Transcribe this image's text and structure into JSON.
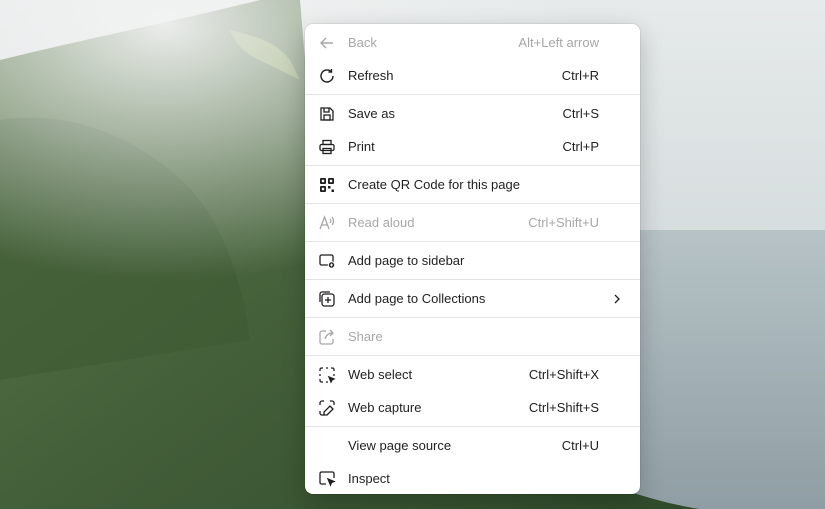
{
  "menu": {
    "items": [
      {
        "label": "Back",
        "shortcut": "Alt+Left arrow",
        "icon": "back-arrow-icon",
        "disabled": true
      },
      {
        "label": "Refresh",
        "shortcut": "Ctrl+R",
        "icon": "refresh-icon",
        "disabled": false
      },
      {
        "label": "Save as",
        "shortcut": "Ctrl+S",
        "icon": "save-icon",
        "disabled": false
      },
      {
        "label": "Print",
        "shortcut": "Ctrl+P",
        "icon": "printer-icon",
        "disabled": false
      },
      {
        "label": "Create QR Code for this page",
        "shortcut": "",
        "icon": "qr-code-icon",
        "disabled": false
      },
      {
        "label": "Read aloud",
        "shortcut": "Ctrl+Shift+U",
        "icon": "read-aloud-icon",
        "disabled": true
      },
      {
        "label": "Add page to sidebar",
        "shortcut": "",
        "icon": "sidebar-add-icon",
        "disabled": false
      },
      {
        "label": "Add page to Collections",
        "shortcut": "",
        "icon": "collections-add-icon",
        "disabled": false
      },
      {
        "label": "Share",
        "shortcut": "",
        "icon": "share-icon",
        "disabled": true
      },
      {
        "label": "Web select",
        "shortcut": "Ctrl+Shift+X",
        "icon": "web-select-icon",
        "disabled": false
      },
      {
        "label": "Web capture",
        "shortcut": "Ctrl+Shift+S",
        "icon": "web-capture-icon",
        "disabled": false
      },
      {
        "label": "View page source",
        "shortcut": "Ctrl+U",
        "icon": "",
        "disabled": false
      },
      {
        "label": "Inspect",
        "shortcut": "",
        "icon": "inspect-icon",
        "disabled": false
      }
    ]
  },
  "colors": {
    "text": "#1f1f1f",
    "disabled": "#a7a7a7",
    "separator": "#e3e3e3",
    "menu_bg": "#ffffff"
  }
}
